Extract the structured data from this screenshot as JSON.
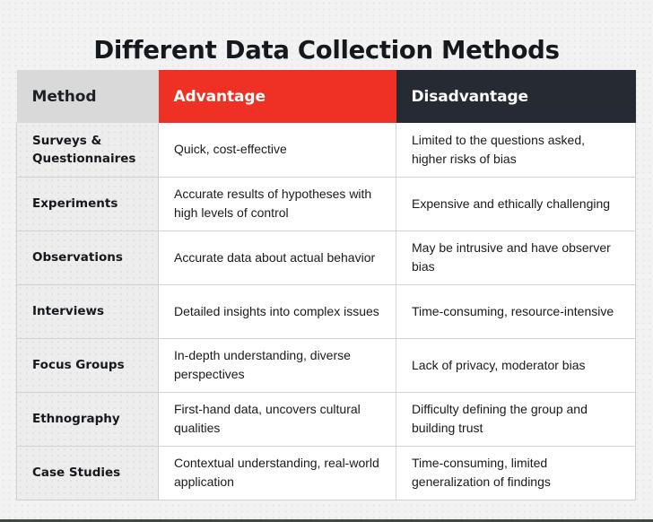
{
  "document": {
    "title": "Different Data Collection Methods",
    "accent_red": "#EE3124",
    "accent_dark": "#262B33",
    "header_gray": "#D9D9D9",
    "page_background": "#F2F2F2",
    "bottom_rule_color": "#3E4C42"
  },
  "table": {
    "columns": [
      {
        "key": "method",
        "label": "Method"
      },
      {
        "key": "advantage",
        "label": "Advantage"
      },
      {
        "key": "disadvantage",
        "label": "Disadvantage"
      }
    ],
    "rows": [
      {
        "method": "Surveys & Questionnaires",
        "advantage": "Quick, cost-effective",
        "disadvantage": "Limited to the questions asked, higher risks of bias"
      },
      {
        "method": "Experiments",
        "advantage": "Accurate results of hypotheses with high levels of control",
        "disadvantage": "Expensive and ethically challenging"
      },
      {
        "method": "Observations",
        "advantage": "Accurate data about actual behavior",
        "disadvantage": "May be intrusive and have observer bias"
      },
      {
        "method": "Interviews",
        "advantage": "Detailed insights into complex issues",
        "disadvantage": "Time-consuming, resource-intensive"
      },
      {
        "method": "Focus Groups",
        "advantage": "In-depth understanding, diverse perspectives",
        "disadvantage": "Lack of privacy, moderator bias"
      },
      {
        "method": "Ethnography",
        "advantage": "First-hand data, uncovers cultural qualities",
        "disadvantage": "Difficulty defining the group and building trust"
      },
      {
        "method": "Case Studies",
        "advantage": "Contextual understanding, real-world application",
        "disadvantage": "Time-consuming, limited generalization of findings"
      }
    ]
  }
}
